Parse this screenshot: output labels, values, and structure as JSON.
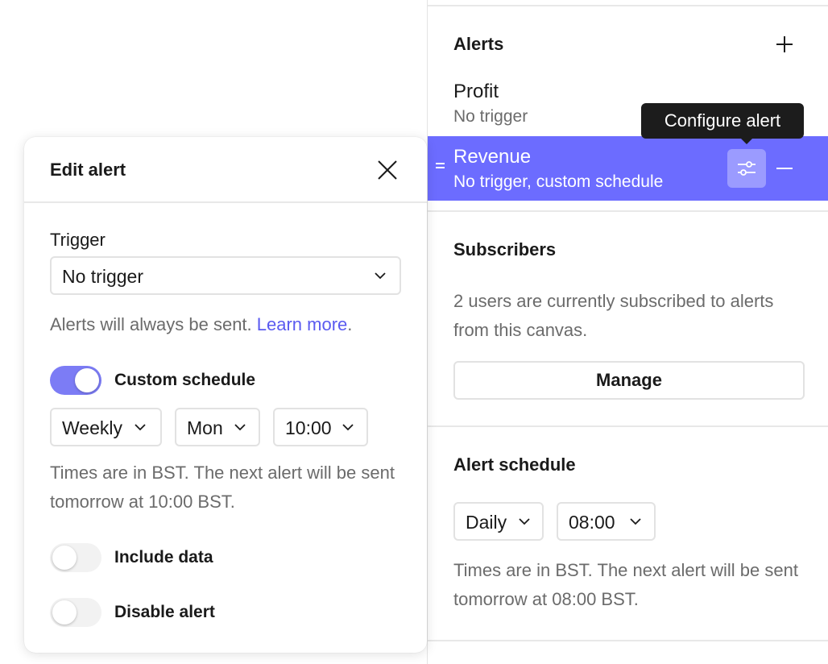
{
  "alerts_panel": {
    "title": "Alerts",
    "add_icon": "plus-icon",
    "items": [
      {
        "name": "Profit",
        "status": "No trigger"
      },
      {
        "name": "Revenue",
        "status": "No trigger, custom schedule"
      }
    ],
    "active_index": 1,
    "active_color": "#6c6cff",
    "configure_icon": "sliders-icon",
    "remove_icon": "minus-icon",
    "drag_icon": "drag-handle-icon",
    "tooltip": "Configure alert"
  },
  "subscribers": {
    "title": "Subscribers",
    "description": "2 users are currently subscribed to alerts from this canvas.",
    "manage_label": "Manage"
  },
  "alert_schedule": {
    "title": "Alert schedule",
    "frequency": "Daily",
    "time": "08:00",
    "note": "Times are in BST. The next alert will be sent tomorrow at 08:00 BST."
  },
  "edit_alert": {
    "title": "Edit alert",
    "close_icon": "close-icon",
    "trigger_label": "Trigger",
    "trigger_value": "No trigger",
    "hint_text": "Alerts will always be sent. ",
    "hint_link": "Learn more",
    "hint_suffix": ".",
    "custom_schedule": {
      "label": "Custom schedule",
      "on": true
    },
    "frequency": "Weekly",
    "day": "Mon",
    "time": "10:00",
    "schedule_note": "Times are in BST. The next alert will be sent tomorrow at 10:00 BST.",
    "include_data": {
      "label": "Include data",
      "on": false
    },
    "disable_alert": {
      "label": "Disable alert",
      "on": false
    },
    "toggle_on_color": "#7c7cf5",
    "link_color": "#5a5af0"
  }
}
